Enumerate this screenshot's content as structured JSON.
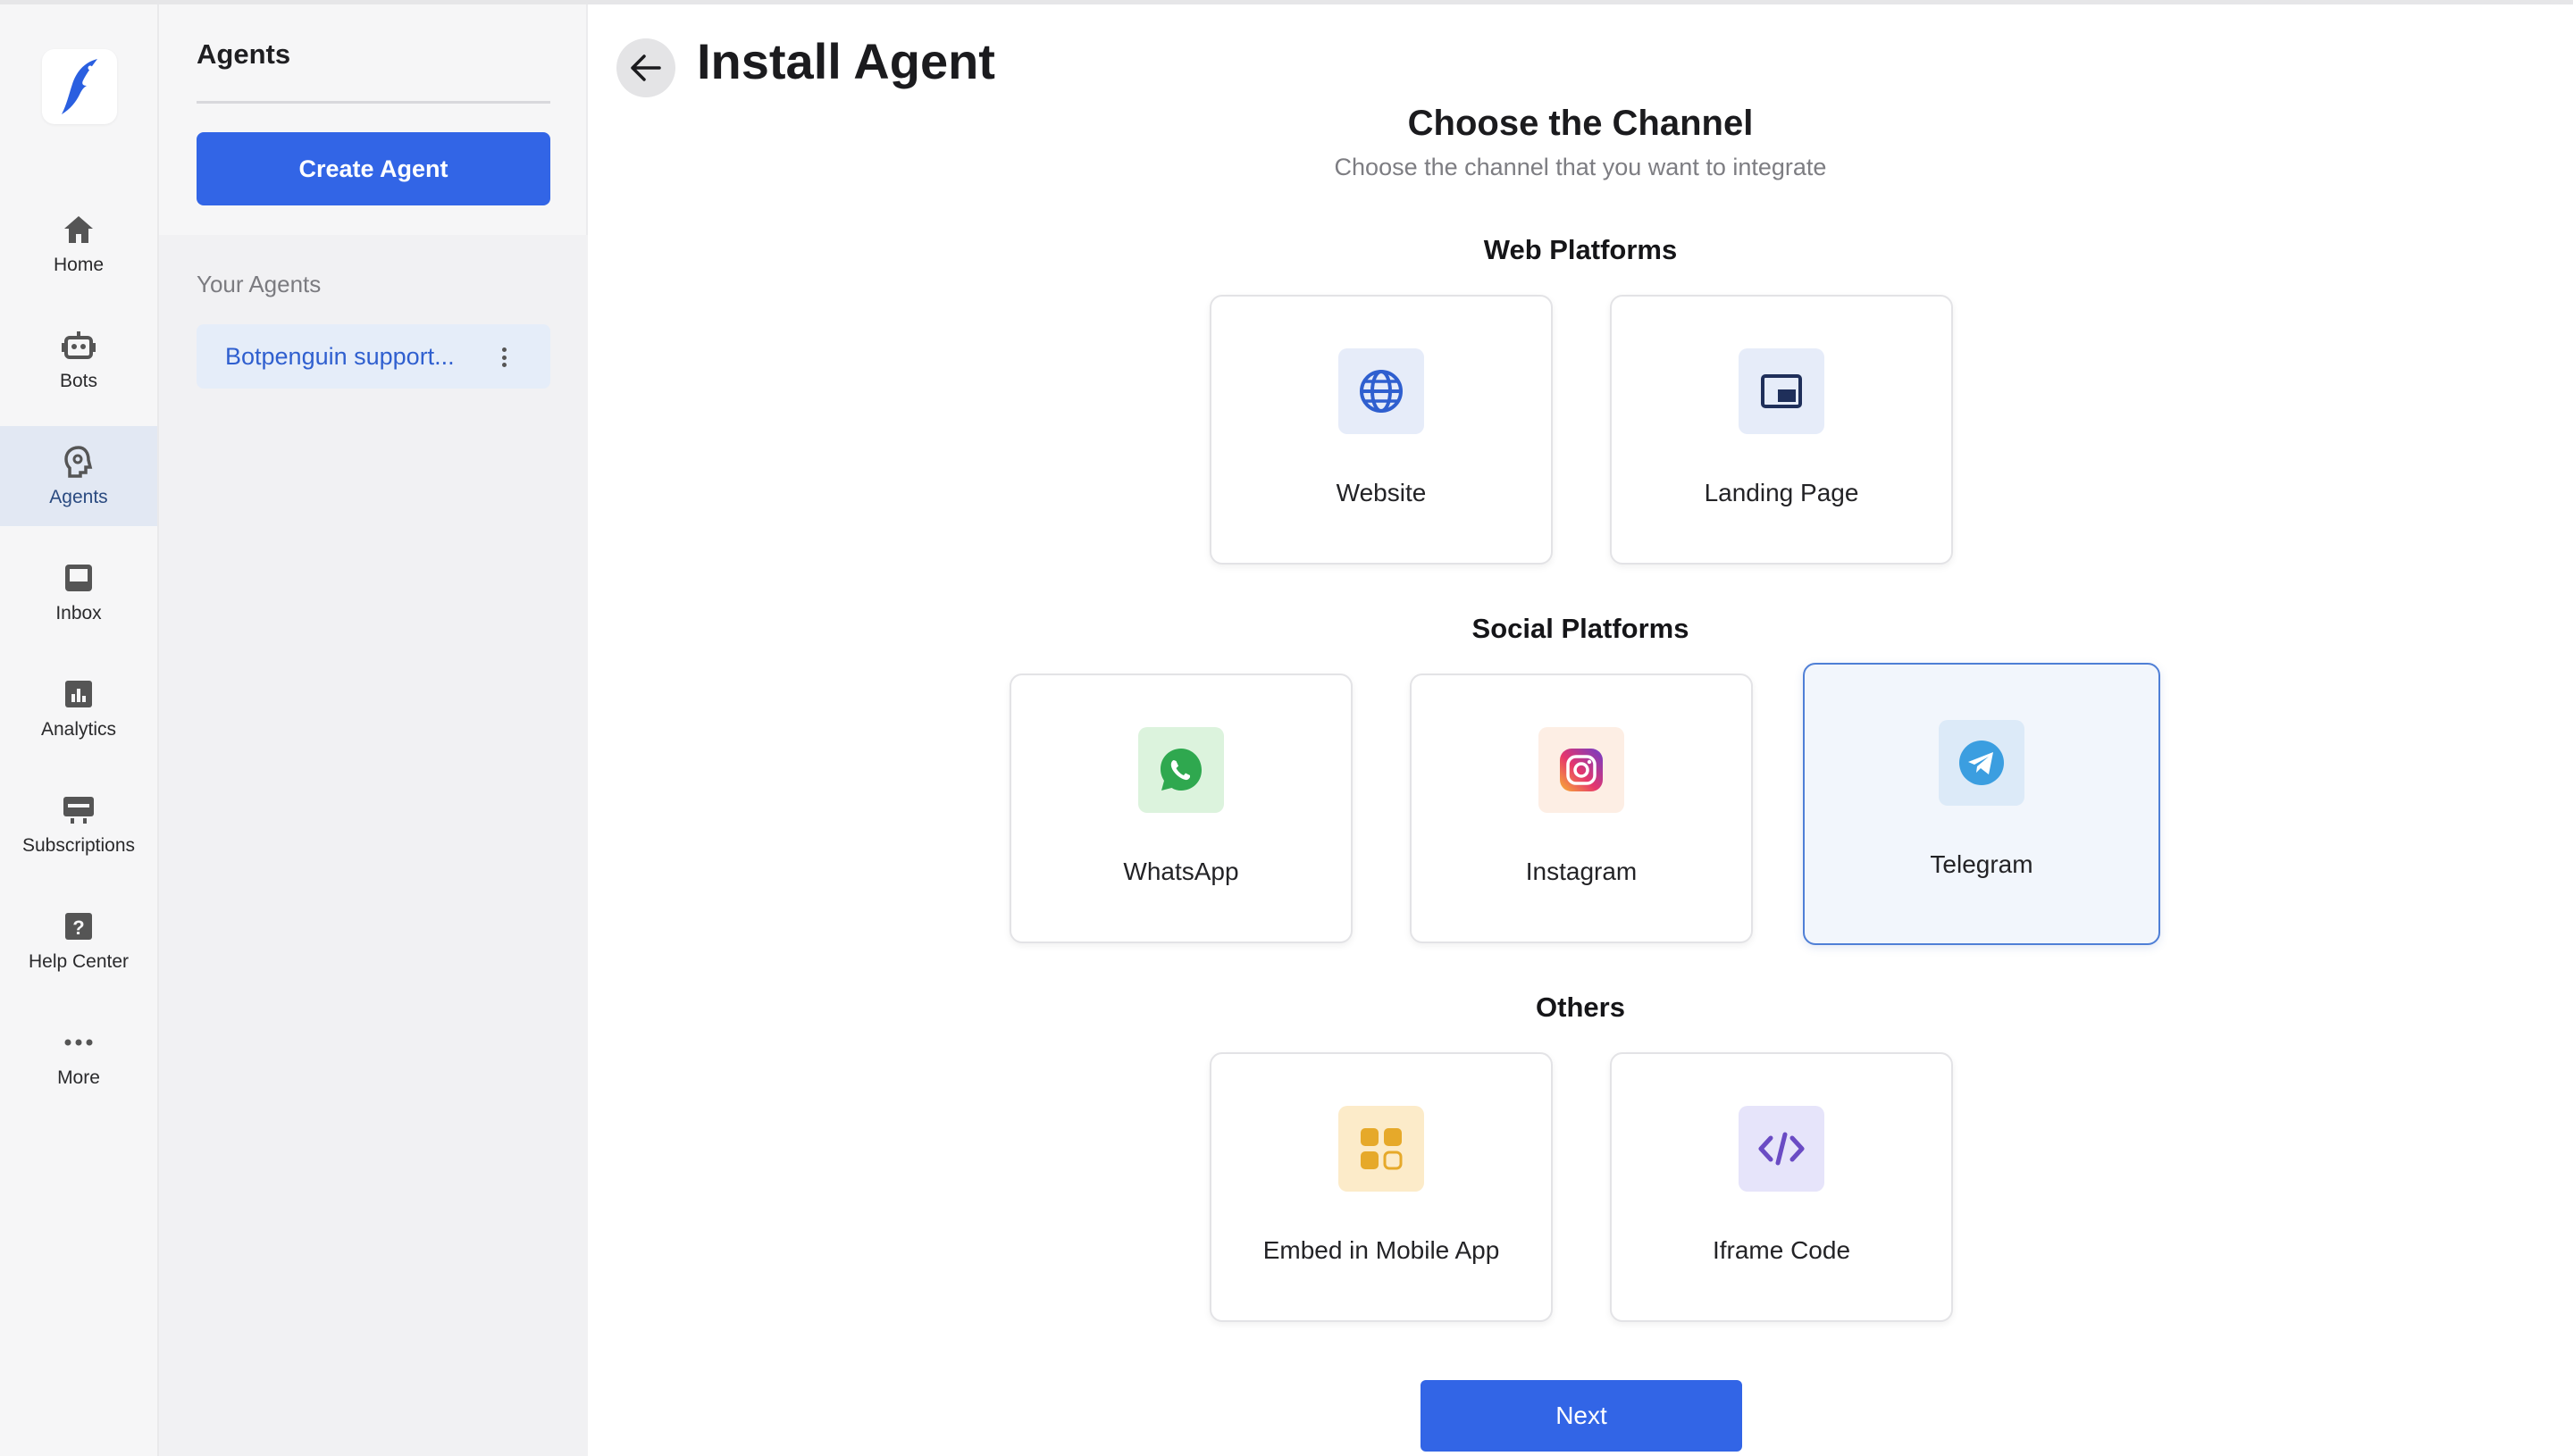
{
  "app": {
    "nav": [
      {
        "id": "home",
        "label": "Home",
        "icon": "home-icon",
        "active": false
      },
      {
        "id": "bots",
        "label": "Bots",
        "icon": "bot-icon",
        "active": false
      },
      {
        "id": "agents",
        "label": "Agents",
        "icon": "agent-head-icon",
        "active": true
      },
      {
        "id": "inbox",
        "label": "Inbox",
        "icon": "inbox-icon",
        "active": false
      },
      {
        "id": "analytics",
        "label": "Analytics",
        "icon": "analytics-icon",
        "active": false
      },
      {
        "id": "subscriptions",
        "label": "Subscriptions",
        "icon": "subscriptions-icon",
        "active": false
      },
      {
        "id": "help",
        "label": "Help Center",
        "icon": "help-icon",
        "active": false
      },
      {
        "id": "more",
        "label": "More",
        "icon": "more-icon",
        "active": false
      }
    ],
    "colors": {
      "accent": "#3265e6",
      "nav_active_bg": "#e2e8f3",
      "selected_border": "#4f7fd6"
    }
  },
  "panel": {
    "title": "Agents",
    "create_label": "Create Agent",
    "your_agents_label": "Your Agents",
    "agents": [
      {
        "name": "Botpenguin support..."
      }
    ]
  },
  "main": {
    "title": "Install Agent",
    "heading": "Choose the Channel",
    "subheading": "Choose the channel that you want to integrate",
    "groups": [
      {
        "title": "Web Platforms",
        "channels": [
          {
            "label": "Website",
            "icon": "globe-icon",
            "selected": false
          },
          {
            "label": "Landing Page",
            "icon": "landing-page-icon",
            "selected": false
          }
        ]
      },
      {
        "title": "Social Platforms",
        "channels": [
          {
            "label": "WhatsApp",
            "icon": "whatsapp-icon",
            "selected": false
          },
          {
            "label": "Instagram",
            "icon": "instagram-icon",
            "selected": false
          },
          {
            "label": "Telegram",
            "icon": "telegram-icon",
            "selected": true
          }
        ]
      },
      {
        "title": "Others",
        "channels": [
          {
            "label": "Embed in Mobile App",
            "icon": "mobile-app-icon",
            "selected": false
          },
          {
            "label": "Iframe Code",
            "icon": "code-icon",
            "selected": false
          }
        ]
      }
    ],
    "next_label": "Next"
  }
}
